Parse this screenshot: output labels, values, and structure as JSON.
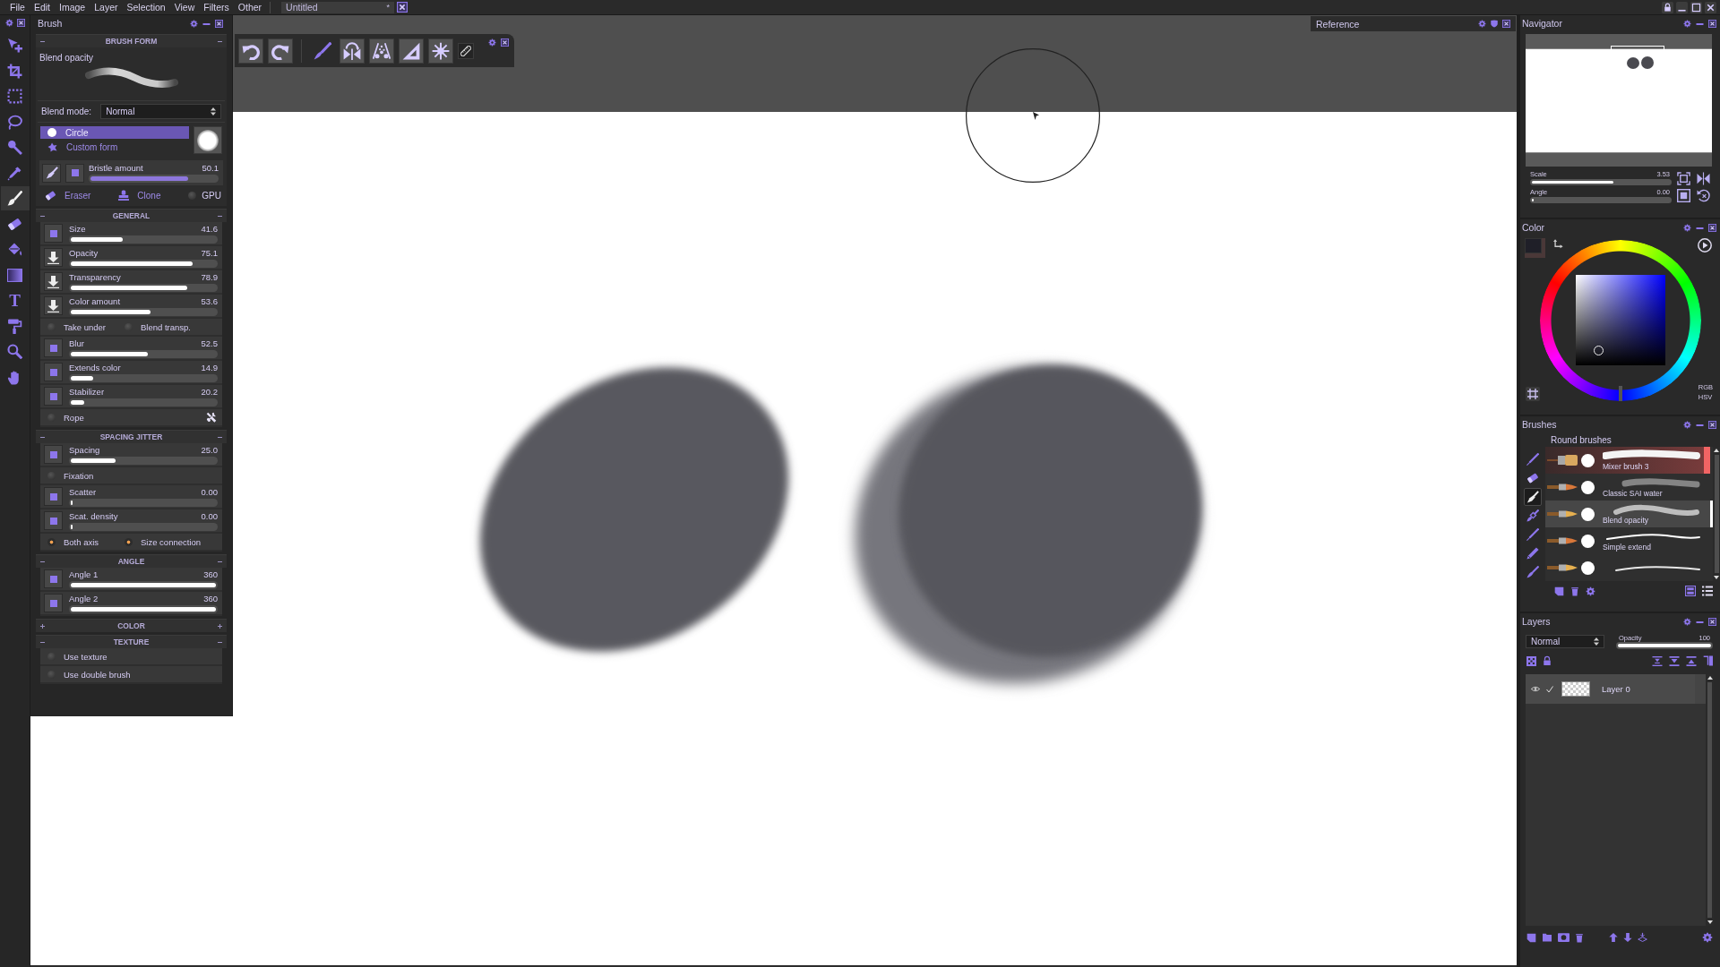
{
  "menu": [
    "File",
    "Edit",
    "Image",
    "Layer",
    "Selection",
    "View",
    "Filters",
    "Other"
  ],
  "document_tab": {
    "title": "Untitled",
    "modified": "*"
  },
  "tools": [
    {
      "selected": false
    },
    {
      "selected": false
    },
    {
      "selected": false
    },
    {
      "selected": false
    },
    {
      "selected": false
    },
    {
      "selected": false
    },
    {
      "selected": true
    },
    {
      "selected": false
    },
    {
      "selected": false
    },
    {
      "selected": false
    },
    {
      "glyph": "T",
      "selected": false
    },
    {
      "selected": false
    },
    {
      "selected": false
    },
    {
      "selected": false
    }
  ],
  "reference_panel": {
    "title": "Reference"
  },
  "brush_panel": {
    "title": "Brush",
    "form": {
      "heading": "BRUSH FORM",
      "expanded": true,
      "brush_name": "Blend opacity",
      "blend_mode": {
        "label": "Blend mode:",
        "value": "Normal"
      },
      "shapes": [
        {
          "label": "Circle",
          "selected": true
        },
        {
          "label": "Custom form",
          "selected": false
        }
      ],
      "bristle": {
        "label": "Bristle amount",
        "reading": "50.1",
        "level": 0.77
      },
      "tools": [
        {
          "label": "Eraser"
        },
        {
          "label": "Clone"
        }
      ],
      "gpu": {
        "label": "GPU",
        "on": false
      }
    },
    "sections": [
      {
        "heading": "GENERAL",
        "expanded": true,
        "rows": [
          {
            "kind": "slider",
            "label": "Size",
            "reading": "41.6",
            "level": 0.36,
            "pressure": false
          },
          {
            "kind": "slider",
            "label": "Opacity",
            "reading": "75.1",
            "level": 0.84,
            "pressure": true
          },
          {
            "kind": "slider",
            "label": "Transparency",
            "reading": "78.9",
            "level": 0.8,
            "pressure": true
          },
          {
            "kind": "slider",
            "label": "Color amount",
            "reading": "53.6",
            "level": 0.55,
            "pressure": true
          },
          {
            "kind": "toggles",
            "items": [
              {
                "label": "Take under",
                "on": false
              },
              {
                "label": "Blend transp.",
                "on": false
              }
            ]
          },
          {
            "kind": "slider",
            "label": "Blur",
            "reading": "52.5",
            "level": 0.53,
            "pressure": false
          },
          {
            "kind": "slider",
            "label": "Extends color",
            "reading": "14.9",
            "level": 0.155,
            "pressure": false
          },
          {
            "kind": "slider",
            "label": "Stabilizer",
            "reading": "20.2",
            "level": 0.095,
            "pressure": false
          },
          {
            "kind": "toggle_tool",
            "items": [
              {
                "label": "Rope",
                "on": false
              }
            ]
          }
        ]
      },
      {
        "heading": "SPACING JITTER",
        "expanded": true,
        "rows": [
          {
            "kind": "slider",
            "label": "Spacing",
            "reading": "25.0",
            "level": 0.31,
            "pressure": false
          },
          {
            "kind": "toggles",
            "items": [
              {
                "label": "Fixation",
                "on": false
              }
            ]
          },
          {
            "kind": "slider",
            "label": "Scatter",
            "reading": "0.00",
            "level": 0.01,
            "pressure": false
          },
          {
            "kind": "slider",
            "label": "Scat. density",
            "reading": "0.00",
            "level": 0,
            "pressure": false
          },
          {
            "kind": "toggles",
            "items": [
              {
                "label": "Both axis",
                "on": true
              },
              {
                "label": "Size connection",
                "on": true
              }
            ]
          }
        ]
      },
      {
        "heading": "ANGLE",
        "expanded": true,
        "rows": [
          {
            "kind": "slider",
            "label": "Angle 1",
            "reading": "360",
            "level": 1,
            "pressure": false
          },
          {
            "kind": "slider",
            "label": "Angle 2",
            "reading": "360",
            "level": 1,
            "pressure": false
          }
        ]
      },
      {
        "heading": "COLOR",
        "expanded": false
      },
      {
        "heading": "TEXTURE",
        "expanded": true,
        "rows": [
          {
            "kind": "toggles",
            "items": [
              {
                "label": "Use texture",
                "on": false
              }
            ]
          },
          {
            "kind": "toggles",
            "items": [
              {
                "label": "Use double brush",
                "on": false
              }
            ]
          }
        ]
      }
    ]
  },
  "navigator": {
    "title": "Navigator",
    "sliders": [
      {
        "label": "Scale",
        "reading": "3.53",
        "level": 0.59
      },
      {
        "label": "Angle",
        "reading": "0.00",
        "level": 0
      }
    ]
  },
  "color_panel": {
    "title": "Color",
    "swatches": [
      {
        "color": "#1f1f28"
      },
      {
        "color": "#4a3838"
      }
    ],
    "modes": [
      "RGB",
      "HSV"
    ]
  },
  "brushes_panel": {
    "title": "Brushes",
    "group": "Round brushes",
    "categories": [
      {
        "selected": false
      },
      {
        "selected": false
      },
      {
        "selected": true
      },
      {
        "selected": false
      },
      {
        "selected": false
      },
      {
        "selected": false
      },
      {
        "selected": false
      }
    ],
    "items": [
      {
        "name": "Mixer brush 3",
        "selected": false,
        "highlighted": true
      },
      {
        "name": "Classic SAI water",
        "selected": false,
        "highlighted": false
      },
      {
        "name": "Blend opacity",
        "selected": true,
        "highlighted": false
      },
      {
        "name": "Simple extend",
        "selected": false,
        "highlighted": false
      },
      {
        "selected": false,
        "highlighted": false
      }
    ]
  },
  "layers_panel": {
    "title": "Layers",
    "blend_mode": "Normal",
    "opacity": {
      "label": "Opacity",
      "reading": "100",
      "level": 1
    },
    "layers": [
      {
        "name": "Layer 0",
        "visible": true,
        "checked": true,
        "selected": true
      }
    ]
  }
}
